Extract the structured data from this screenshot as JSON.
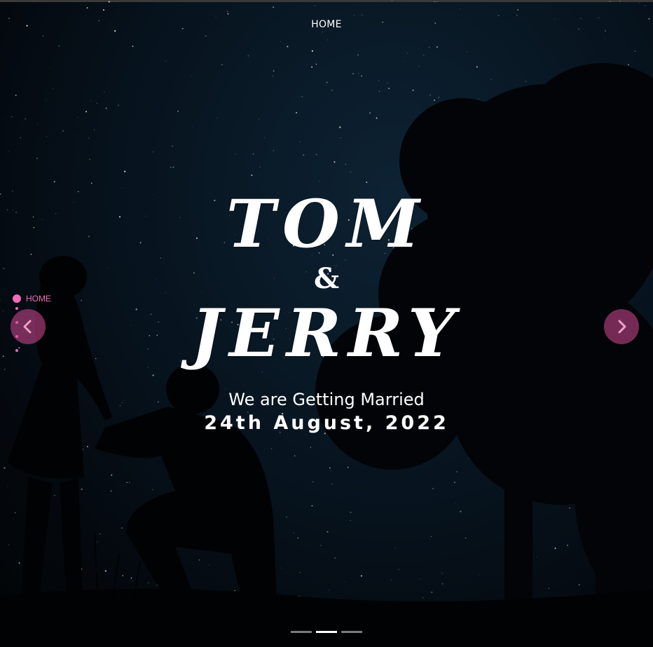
{
  "nav": {
    "home_label": "HOME"
  },
  "side_nav": {
    "items": [
      {
        "label": "HOME",
        "active": true
      },
      {
        "label": "",
        "active": false
      },
      {
        "label": "",
        "active": false
      },
      {
        "label": "",
        "active": false
      },
      {
        "label": "",
        "active": false
      }
    ]
  },
  "hero": {
    "name1": "TOM",
    "ampersand": "&",
    "name2": "JERRY",
    "tagline": "We are Getting Married",
    "date": "24th August, 2022"
  },
  "carousel": {
    "indicator_count": 3,
    "active_index": 1,
    "prev_icon": "chevron-left-icon",
    "next_icon": "chevron-right-icon"
  },
  "colors": {
    "accent": "#f06cb9",
    "arrow_bg": "#d64a96",
    "sky": "#07141f"
  }
}
